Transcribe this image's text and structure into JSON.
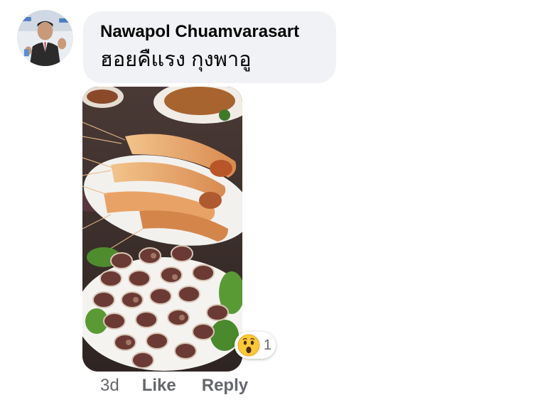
{
  "comment": {
    "author": "Nawapol Chuamvarasart",
    "text": "ฮอยคืแรง กุงพาอู",
    "timestamp": "3d",
    "like_label": "Like",
    "reply_label": "Reply",
    "reaction": {
      "icon": "wow-reaction-icon",
      "count": "1"
    }
  },
  "colors": {
    "bubble": "#f0f2f5",
    "meta_text": "#65676b",
    "primary_text": "#050505"
  }
}
